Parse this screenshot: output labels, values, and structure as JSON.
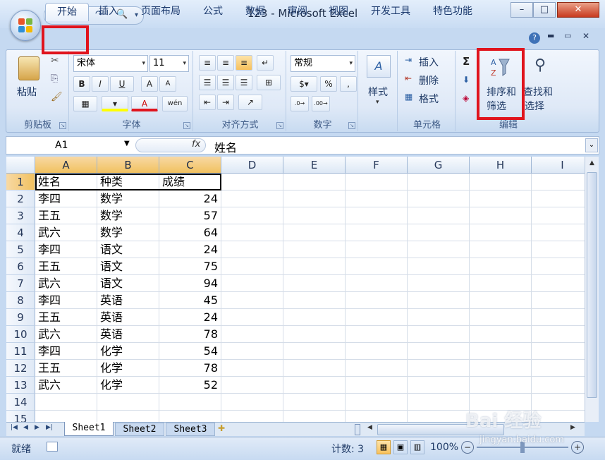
{
  "window": {
    "title": "123 - Microsoft Excel",
    "minimize": "–",
    "maximize": "□",
    "close": "✕"
  },
  "quick_access": {
    "save": "💾",
    "undo": "↶",
    "redo": "↷",
    "print_preview": "🔍",
    "more": "▾"
  },
  "tabs": [
    "开始",
    "插入",
    "页面布局",
    "公式",
    "数据",
    "审阅",
    "视图",
    "开发工具",
    "特色功能"
  ],
  "ribbon": {
    "clipboard": {
      "paste": "粘贴",
      "label": "剪贴板"
    },
    "font": {
      "name": "宋体",
      "size": "11",
      "bold": "B",
      "italic": "I",
      "underline": "U",
      "grow": "A",
      "shrink": "A",
      "label": "字体",
      "wen": "wén"
    },
    "alignment": {
      "label": "对齐方式"
    },
    "number": {
      "format": "常规",
      "percent": "%",
      "comma": ",",
      "label": "数字"
    },
    "styles": {
      "label": "样式"
    },
    "cells": {
      "insert": "插入",
      "delete": "删除",
      "format": "格式",
      "label": "单元格"
    },
    "editing": {
      "sum": "Σ",
      "sort_filter_line1": "排序和",
      "sort_filter_line2": "筛选",
      "find_select_line1": "查找和",
      "find_select_line2": "选择",
      "label": "编辑"
    }
  },
  "formula_bar": {
    "cell_ref": "A1",
    "fx": "fx",
    "content": "姓名"
  },
  "sheet": {
    "columns": [
      "A",
      "B",
      "C",
      "D",
      "E",
      "F",
      "G",
      "H",
      "I"
    ],
    "row_numbers": [
      "1",
      "2",
      "3",
      "4",
      "5",
      "6",
      "7",
      "8",
      "9",
      "10",
      "11",
      "12",
      "13",
      "14",
      "15"
    ],
    "headers": [
      "姓名",
      "种类",
      "成绩"
    ],
    "rows": [
      [
        "李四",
        "数学",
        "24"
      ],
      [
        "王五",
        "数学",
        "57"
      ],
      [
        "武六",
        "数学",
        "64"
      ],
      [
        "李四",
        "语文",
        "24"
      ],
      [
        "王五",
        "语文",
        "75"
      ],
      [
        "武六",
        "语文",
        "94"
      ],
      [
        "李四",
        "英语",
        "45"
      ],
      [
        "王五",
        "英语",
        "24"
      ],
      [
        "武六",
        "英语",
        "78"
      ],
      [
        "李四",
        "化学",
        "54"
      ],
      [
        "王五",
        "化学",
        "78"
      ],
      [
        "武六",
        "化学",
        "52"
      ]
    ]
  },
  "sheet_tabs": [
    "Sheet1",
    "Sheet2",
    "Sheet3"
  ],
  "status": {
    "ready": "就绪",
    "count": "计数: 3",
    "zoom": "100%"
  },
  "watermark": {
    "brand": "Bai 经验",
    "url": "jingyan.baidu.com"
  },
  "colors": {
    "accent_red": "#e0141d",
    "selected_header": "#f1c15f",
    "ribbon_bg": "#dfe9f7"
  }
}
